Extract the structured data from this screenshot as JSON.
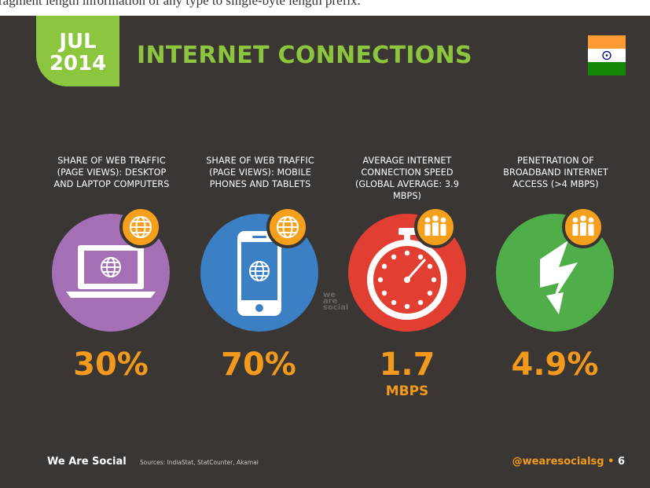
{
  "top_caption": "ragment length information of any type to single-byte length prefix.",
  "header": {
    "month": "JUL",
    "year": "2014",
    "title": "INTERNET CONNECTIONS"
  },
  "columns": [
    {
      "label_lines": [
        "SHARE OF WEB TRAFFIC",
        "(PAGE VIEWS): DESKTOP",
        "AND LAPTOP COMPUTERS"
      ],
      "value": "30%",
      "unit": "",
      "circle_color": "#a46fb4",
      "icon": "laptop-icon",
      "badge_icon": "globe-icon"
    },
    {
      "label_lines": [
        "SHARE OF WEB TRAFFIC",
        "(PAGE VIEWS): MOBILE",
        "PHONES AND TABLETS"
      ],
      "value": "70%",
      "unit": "",
      "circle_color": "#3b80c4",
      "icon": "smartphone-icon",
      "badge_icon": "globe-icon"
    },
    {
      "label_lines": [
        "AVERAGE INTERNET",
        "CONNECTION SPEED",
        "(GLOBAL AVERAGE: 3.9 MBPS)"
      ],
      "value": "1.7",
      "unit": "MBPS",
      "circle_color": "#e23f33",
      "icon": "stopwatch-icon",
      "badge_icon": "people-icon"
    },
    {
      "label_lines": [
        "PENETRATION OF",
        "BROADBAND INTERNET",
        "ACCESS (>4 MBPS)"
      ],
      "value": "4.9%",
      "unit": "",
      "circle_color": "#4fae49",
      "icon": "lightning-bolt-icon",
      "badge_icon": "people-icon"
    }
  ],
  "watermark": [
    "we",
    "are",
    "social"
  ],
  "footer": {
    "brand": "We Are Social",
    "sources": "Sources: IndiaStat, StatCounter, Akamai",
    "handle": "@wearesocialsg",
    "page": "6"
  },
  "colors": {
    "background": "#3a3634",
    "accent_green": "#8cc63f",
    "accent_orange": "#f29a1d",
    "badge_orange": "#f5a01d"
  },
  "flag_icon": "india-flag-icon"
}
